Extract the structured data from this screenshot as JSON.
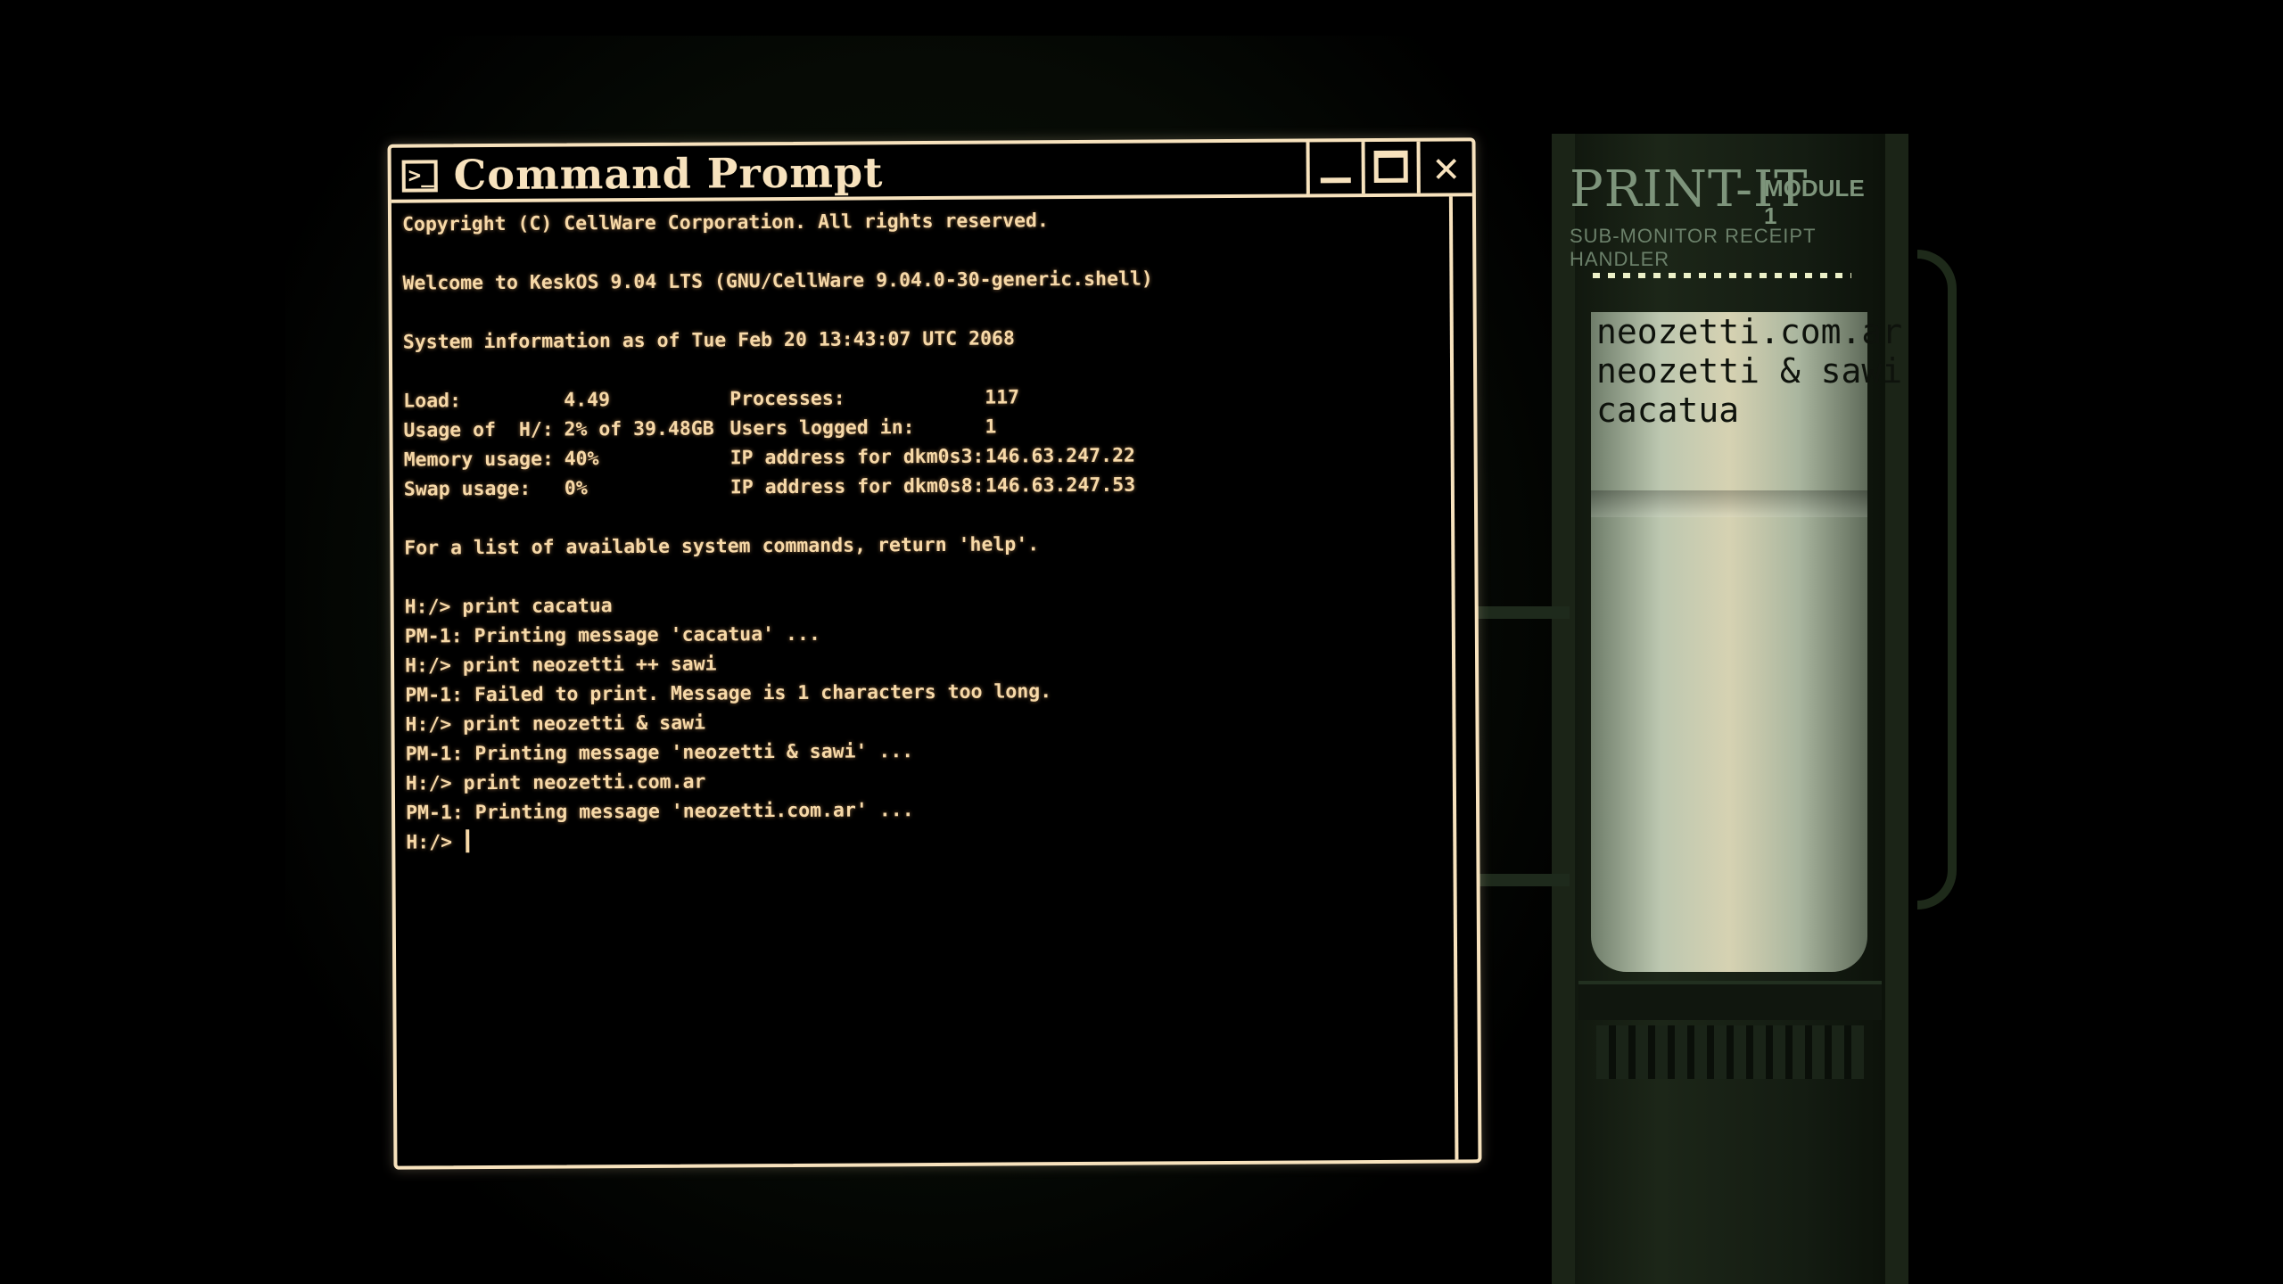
{
  "window": {
    "title": "Command Prompt",
    "close_glyph": "✕",
    "icon_glyph": ">_"
  },
  "console": {
    "copyright": "Copyright (C) CellWare Corporation. All rights reserved.",
    "welcome": "Welcome to KeskOS 9.04 LTS (GNU/CellWare 9.04.0-30-generic.shell)",
    "sysinfo_header": "System information as of Tue Feb 20 13:43:07 UTC 2068",
    "sysinfo": [
      [
        "Load:",
        "4.49",
        "Processes:",
        "117"
      ],
      [
        "Usage of  H/:",
        "2% of 39.48GB",
        "Users logged in:",
        "1"
      ],
      [
        "Memory usage:",
        "40%",
        "IP address for dkm0s3:",
        "146.63.247.22"
      ],
      [
        "Swap usage:",
        "0%",
        "IP address for dkm0s8:",
        "146.63.247.53"
      ]
    ],
    "help_hint": "For a list of available system commands, return 'help'.",
    "history": [
      "H:/> print cacatua",
      "PM-1: Printing message 'cacatua' ...",
      "H:/> print neozetti ++ sawi",
      "PM-1: Failed to print. Message is 1 characters too long.",
      "H:/> print neozetti & sawi",
      "PM-1: Printing message 'neozetti & sawi' ...",
      "H:/> print neozetti.com.ar",
      "PM-1: Printing message 'neozetti.com.ar' ..."
    ],
    "prompt": "H:/> "
  },
  "printer": {
    "brand": "PRINT-IT",
    "module": "MODULE 1",
    "subtitle": "SUB-MONITOR RECEIPT HANDLER",
    "receipt_lines": [
      "neozetti.com.ar",
      "neozetti & sawi",
      "cacatua"
    ]
  }
}
